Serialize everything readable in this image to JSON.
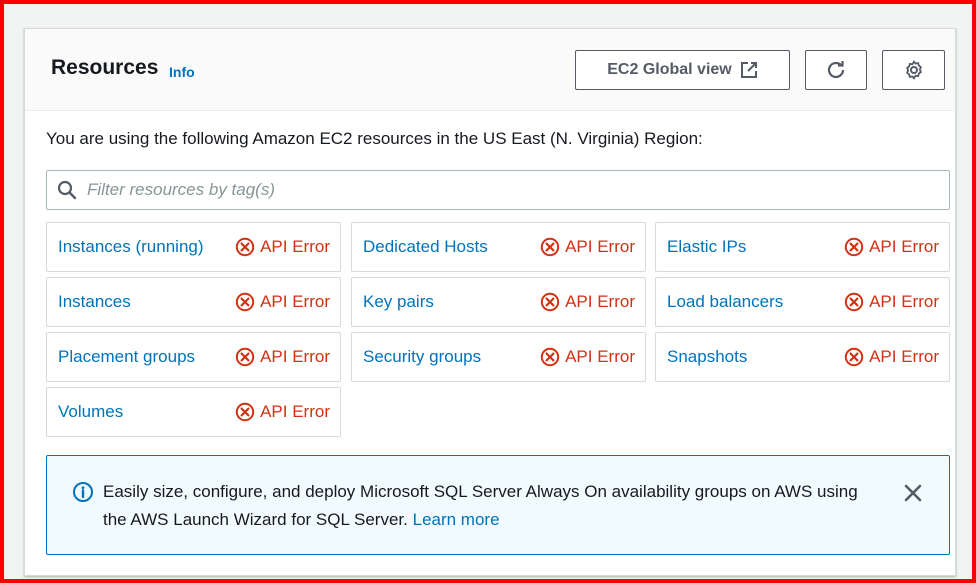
{
  "header": {
    "title": "Resources",
    "info_label": "Info",
    "global_view_label": "EC2 Global view"
  },
  "intro_text": "You are using the following Amazon EC2 resources in the US East (N. Virginia) Region:",
  "filter": {
    "placeholder": "Filter resources by tag(s)",
    "value": ""
  },
  "resources": [
    {
      "label": "Instances (running)",
      "status": "API Error"
    },
    {
      "label": "Dedicated Hosts",
      "status": "API Error"
    },
    {
      "label": "Elastic IPs",
      "status": "API Error"
    },
    {
      "label": "Instances",
      "status": "API Error"
    },
    {
      "label": "Key pairs",
      "status": "API Error"
    },
    {
      "label": "Load balancers",
      "status": "API Error"
    },
    {
      "label": "Placement groups",
      "status": "API Error"
    },
    {
      "label": "Security groups",
      "status": "API Error"
    },
    {
      "label": "Snapshots",
      "status": "API Error"
    },
    {
      "label": "Volumes",
      "status": "API Error"
    }
  ],
  "flash": {
    "message": "Easily size, configure, and deploy Microsoft SQL Server Always On availability groups on AWS using the AWS Launch Wizard for SQL Server. ",
    "link_label": "Learn more"
  },
  "colors": {
    "link": "#0073bb",
    "error": "#d13212",
    "frame_border": "#ff0000",
    "flash_border": "#0073bb",
    "flash_bg": "#f1faff"
  },
  "icons": {
    "global_view": "external-link-icon",
    "refresh": "refresh-icon",
    "settings": "gear-icon",
    "filter": "search-icon",
    "error": "error-circle-x-icon",
    "flash": "info-circle-icon",
    "dismiss": "close-icon"
  }
}
